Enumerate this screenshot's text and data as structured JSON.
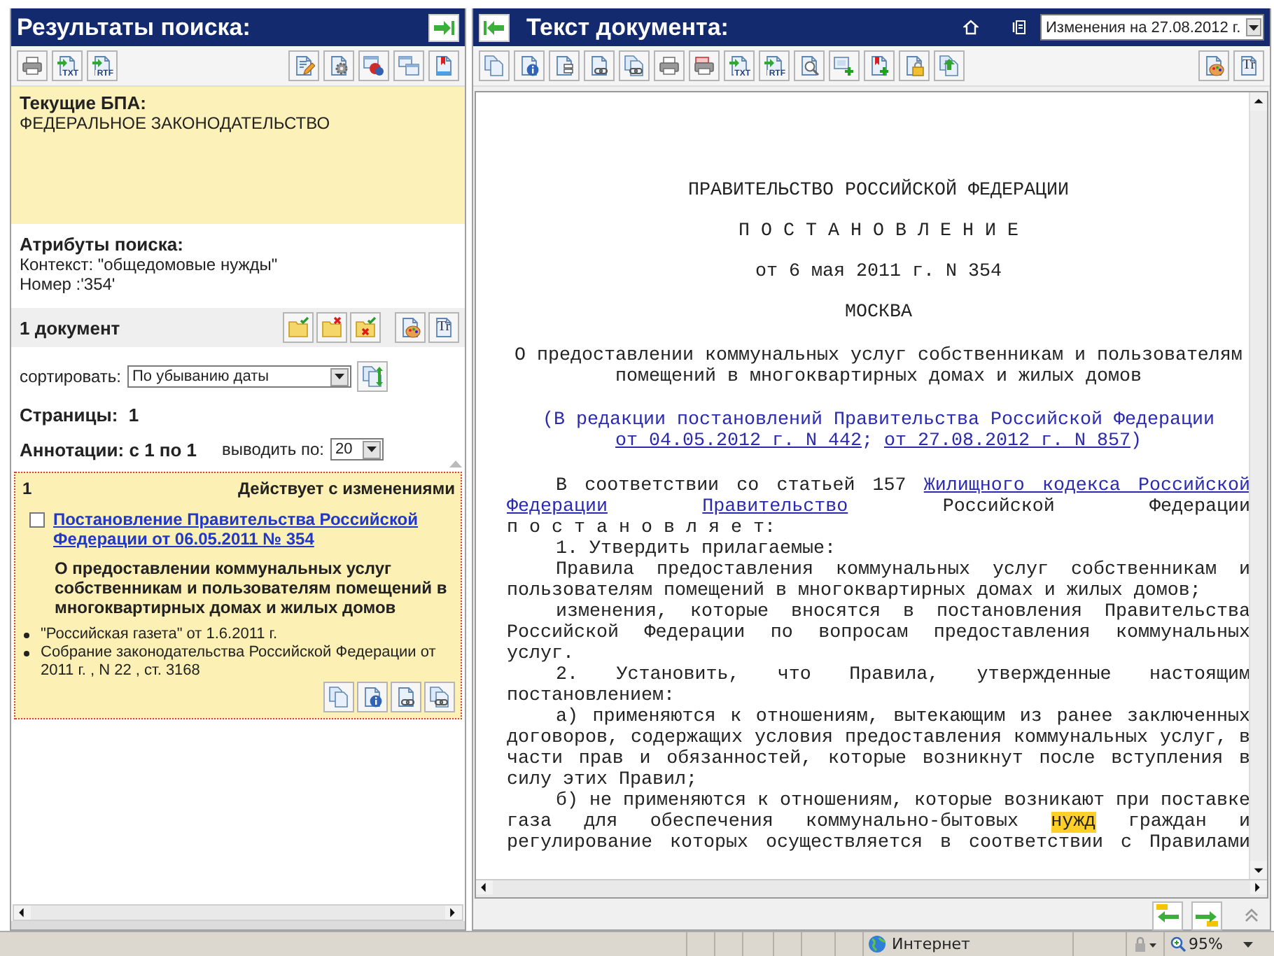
{
  "left_panel": {
    "title": "Результаты поиска:",
    "toolbar_left": [
      {
        "kind": "print"
      },
      {
        "kind": "export",
        "label": "TXT"
      },
      {
        "kind": "export",
        "label": "RTF"
      }
    ],
    "toolbar_right": [
      {
        "kind": "edit"
      },
      {
        "kind": "settings"
      },
      {
        "kind": "filter"
      },
      {
        "kind": "windows"
      },
      {
        "kind": "bookmark"
      }
    ],
    "current_bpa": {
      "heading": "Текущие БПА:",
      "value": "ФЕДЕРАЛЬНОЕ ЗАКОНОДАТЕЛЬСТВО"
    },
    "search_attributes": {
      "heading": "Атрибуты поиска:",
      "lines": [
        "Контекст: \"общедомовые нужды\"",
        "Номер :'354'"
      ]
    },
    "document_count": "1 документ",
    "count_toolbar": [
      {
        "kind": "folder-check"
      },
      {
        "kind": "folder-cross"
      },
      {
        "kind": "folder-both"
      },
      {
        "kind": "palette"
      },
      {
        "kind": "font",
        "label": "Tr"
      }
    ],
    "sort": {
      "label": "сортировать:",
      "value": "По убыванию даты"
    },
    "pages": {
      "label": "Страницы:",
      "value": "1"
    },
    "annotations": {
      "label": "Аннотации: с 1 по 1",
      "per_page_label": "выводить по:",
      "per_page": "20"
    },
    "results": [
      {
        "number": "1",
        "status": "Действует с изменениями",
        "checked": false,
        "title": "Постановление Правительства Российской Федерации от 06.05.2011 № 354",
        "summary": "О предоставлении коммунальных услуг собственникам и пользователям помещений в многоквартирных домах и жилых домов",
        "sources": [
          "\"Российская газета\" от 1.6.2011 г.",
          "Собрание законодательства Российской Федерации от 2011 г. , N 22 , ст. 3168"
        ],
        "actions": [
          {
            "kind": "copy"
          },
          {
            "kind": "info"
          },
          {
            "kind": "link"
          },
          {
            "kind": "link2"
          }
        ]
      }
    ]
  },
  "right_panel": {
    "title": "Текст документа:",
    "edition": "Изменения на 27.08.2012 г.",
    "toolbar": [
      {
        "kind": "copy"
      },
      {
        "kind": "info"
      },
      {
        "kind": "tree"
      },
      {
        "kind": "link"
      },
      {
        "kind": "link2"
      },
      {
        "kind": "print"
      },
      {
        "kind": "print-marked"
      },
      {
        "kind": "export",
        "label": "TXT"
      },
      {
        "kind": "export",
        "label": "RTF"
      },
      {
        "kind": "search"
      },
      {
        "kind": "window-add"
      },
      {
        "kind": "bookmark-add"
      },
      {
        "kind": "lock"
      },
      {
        "kind": "tree-up"
      }
    ],
    "toolbar_right": [
      {
        "kind": "palette"
      },
      {
        "kind": "font",
        "label": "Tr"
      }
    ],
    "document": [
      {
        "kind": "heading",
        "segments": [
          {
            "kind": "text",
            "text": "ПРАВИТЕЛЬСТВО РОССИЙСКОЙ ФЕДЕРАЦИИ"
          }
        ]
      },
      {
        "kind": "heading",
        "segments": [
          {
            "kind": "text",
            "text": "П О С Т А Н О В Л Е Н И Е"
          }
        ]
      },
      {
        "kind": "heading",
        "segments": [
          {
            "kind": "text",
            "text": "от 6 мая 2011 г. N 354"
          }
        ]
      },
      {
        "kind": "heading",
        "segments": [
          {
            "kind": "text",
            "text": "МОСКВА"
          }
        ]
      },
      {
        "kind": "title",
        "segments": [
          {
            "kind": "text",
            "text": "О предоставлении коммунальных услуг собственникам и пользователям помещений в многоквартирных домах и жилых домов"
          }
        ]
      },
      {
        "kind": "note",
        "segments": [
          {
            "kind": "text",
            "text": "(В редакции постановлений Правительства Российской Федерации "
          },
          {
            "kind": "link",
            "text": "от 04.05.2012 г. N 442"
          },
          {
            "kind": "text",
            "text": "; "
          },
          {
            "kind": "link",
            "text": "от 27.08.2012 г. N 857"
          },
          {
            "kind": "text",
            "text": ")"
          }
        ]
      },
      {
        "kind": "para-full",
        "segments": [
          {
            "kind": "text",
            "text": "В соответствии со статьей 157 "
          },
          {
            "kind": "link",
            "text": "Жилищного кодекса Российской"
          },
          {
            "kind": "link",
            "text": "Федерации"
          },
          {
            "kind": "link",
            "text": "Правительство"
          },
          {
            "kind": "text",
            "text": " Российской Федерации"
          }
        ]
      },
      {
        "kind": "plain",
        "segments": [
          {
            "kind": "text",
            "text": "п о с т а н о в л я е т:"
          }
        ]
      },
      {
        "kind": "para",
        "segments": [
          {
            "kind": "text",
            "text": "1. Утвердить прилагаемые:"
          }
        ]
      },
      {
        "kind": "para",
        "segments": [
          {
            "kind": "text",
            "text": "Правила предоставления коммунальных услуг собственникам и пользователям помещений в многоквартирных домах и жилых домов;"
          }
        ]
      },
      {
        "kind": "para",
        "segments": [
          {
            "kind": "text",
            "text": "изменения, которые вносятся в постановления Правительства Российской Федерации по вопросам предоставления коммунальных услуг."
          }
        ]
      },
      {
        "kind": "para",
        "segments": [
          {
            "kind": "text",
            "text": "2. Установить, что Правила, утвержденные настоящим постановлением:"
          }
        ]
      },
      {
        "kind": "para",
        "segments": [
          {
            "kind": "text",
            "text": "а) применяются к отношениям, вытекающим из ранее заключенных договоров, содержащих условия предоставления коммунальных услуг, в части прав и обязанностей, которые возникнут после вступления в силу этих Правил;"
          }
        ]
      },
      {
        "kind": "para-full",
        "segments": [
          {
            "kind": "text",
            "text": "б) не применяются к отношениям, которые возникают при поставке газа для обеспечения коммунально-бытовых "
          },
          {
            "kind": "highlight",
            "text": "нужд"
          },
          {
            "kind": "text",
            "text": " граждан и регулирование которых осуществляется в соответствии с Правилами"
          }
        ]
      }
    ]
  },
  "nav": [
    {
      "kind": "prev"
    },
    {
      "kind": "next"
    }
  ],
  "status_bar": {
    "zone": "Интернет",
    "zoom": "95%"
  }
}
